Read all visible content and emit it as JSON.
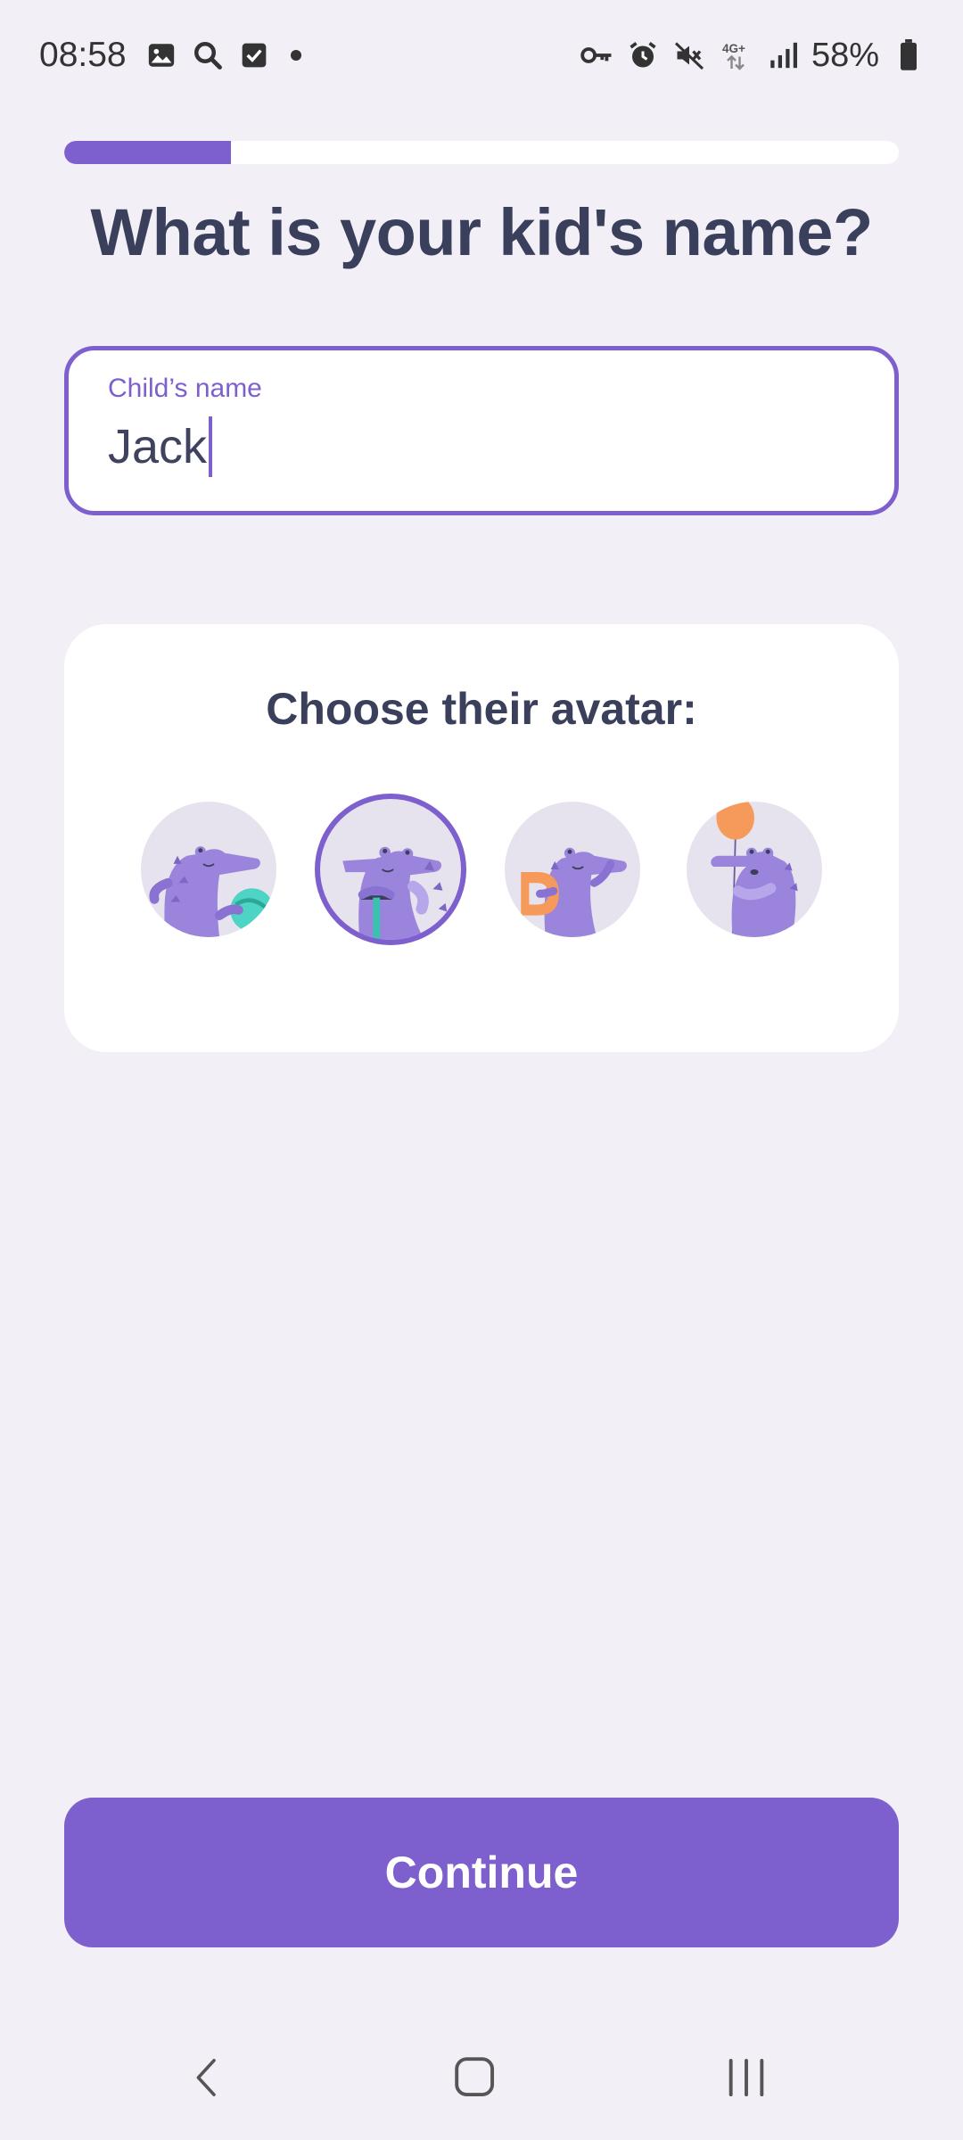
{
  "status_bar": {
    "time": "08:58",
    "battery": "58%",
    "left_icons": [
      "gallery-icon",
      "search-icon",
      "checkbox-icon",
      "dot-icon"
    ],
    "right_icons": [
      "vpn-key-icon",
      "alarm-icon",
      "mute-icon",
      "4g-icon",
      "signal-icon",
      "battery-icon"
    ]
  },
  "progress": {
    "fraction": 0.2
  },
  "page": {
    "title": "What is your kid's name?"
  },
  "name_field": {
    "label": "Child’s name",
    "value": "Jack"
  },
  "avatar": {
    "heading": "Choose their avatar:",
    "selected_index": 1,
    "options": [
      {
        "name": "crocodile-with-ball",
        "prop_color": "#4dd4c4"
      },
      {
        "name": "crocodile-with-scooter",
        "prop_color": "#3cc0b0"
      },
      {
        "name": "crocodile-with-letter",
        "prop_color": "#f59a5a"
      },
      {
        "name": "crocodile-with-balloon",
        "prop_color": "#f59a5a"
      }
    ]
  },
  "buttons": {
    "continue": "Continue"
  },
  "colors": {
    "accent": "#7d5fcd",
    "title": "#3a3f5c",
    "background": "#f2eff7",
    "avatar_bg": "#e7e3ee",
    "croc": "#9b84dc"
  },
  "nav": {
    "items": [
      "back-icon",
      "home-icon",
      "recents-icon"
    ]
  }
}
